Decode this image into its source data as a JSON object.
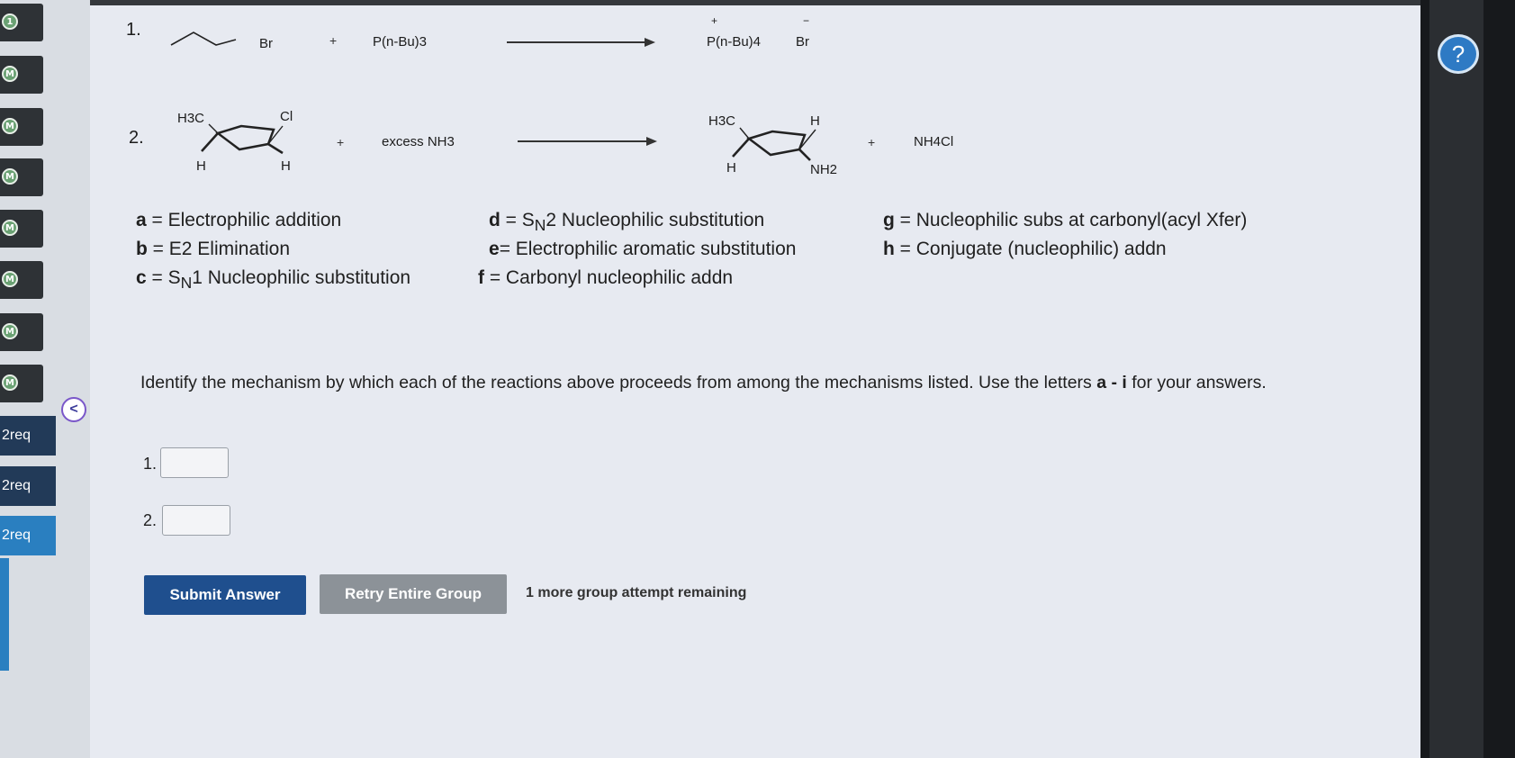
{
  "sidebar": {
    "badges": [
      "1",
      "M",
      "M",
      "M",
      "M",
      "M",
      "M",
      "M"
    ],
    "req_items": [
      "2req",
      "2req",
      "2req"
    ]
  },
  "header": {
    "help_label": "?"
  },
  "reactions": [
    {
      "number": "1.",
      "reactant1_label": "Br",
      "plus1": "+",
      "reagent": "P(n-Bu)3",
      "product1": "P(n-Bu)4",
      "product1_charge": "+",
      "product2": "Br",
      "product2_charge": "−"
    },
    {
      "number": "2.",
      "reactant_labels": [
        "H3C",
        "Cl",
        "H",
        "H"
      ],
      "plus1": "+",
      "reagent": "excess NH3",
      "product_labels": [
        "H3C",
        "H",
        "H",
        "NH2"
      ],
      "plus2": "+",
      "byproduct": "NH4Cl"
    }
  ],
  "mechanisms": [
    {
      "letter": "a",
      "text": " = Electrophilic addition"
    },
    {
      "letter": "b",
      "text": " = E2 Elimination"
    },
    {
      "letter": "c",
      "text": " = S",
      "sub": "N",
      "text2": "1 Nucleophilic substitution"
    },
    {
      "letter": "d",
      "text": " = S",
      "sub": "N",
      "text2": "2 Nucleophilic substitution"
    },
    {
      "letter": "e",
      "text": "= Electrophilic aromatic substitution"
    },
    {
      "letter": "f",
      "text": " = Carbonyl nucleophilic addn"
    },
    {
      "letter": "g",
      "text": " = Nucleophilic subs at carbonyl(acyl Xfer)"
    },
    {
      "letter": "h",
      "text": " = Conjugate (nucleophilic) addn"
    }
  ],
  "question": {
    "text_before": "Identify the mechanism by which each of the reactions above proceeds from among the mechanisms listed. Use the letters ",
    "range": "a - i",
    "text_after": " for your answers."
  },
  "answers": [
    {
      "label": "1.",
      "value": ""
    },
    {
      "label": "2.",
      "value": ""
    }
  ],
  "buttons": {
    "submit": "Submit Answer",
    "retry": "Retry Entire Group"
  },
  "attempts_text": "1 more group attempt remaining",
  "collapse_label": "<"
}
